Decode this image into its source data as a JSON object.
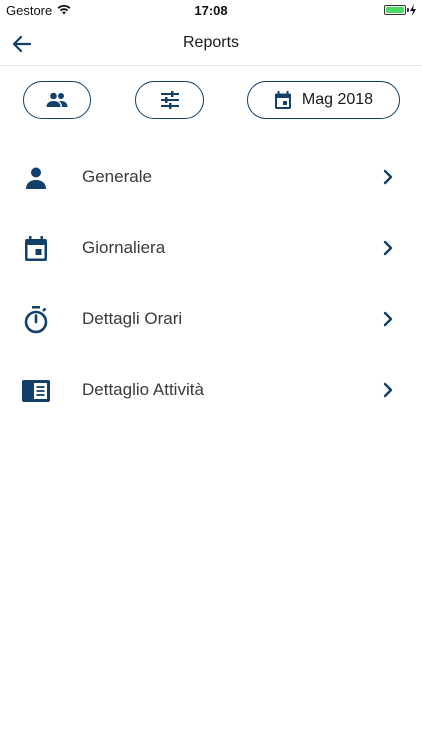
{
  "status_bar": {
    "carrier": "Gestore",
    "time": "17:08",
    "battery_color": "#4cd964"
  },
  "nav": {
    "title": "Reports",
    "back_icon": "arrow-left-icon"
  },
  "filters": {
    "users_icon": "people-icon",
    "filters_icon": "sliders-icon",
    "date_icon": "calendar-icon",
    "date_label": "Mag 2018"
  },
  "reports": [
    {
      "label": "Generale",
      "icon": "person-icon"
    },
    {
      "label": "Giornaliera",
      "icon": "calendar-icon"
    },
    {
      "label": "Dettagli Orari",
      "icon": "stopwatch-icon"
    },
    {
      "label": "Dettaglio Attività",
      "icon": "document-list-icon"
    }
  ],
  "colors": {
    "accent": "#12406a",
    "text": "#3a3a3a",
    "divider": "#e2e2e2"
  }
}
